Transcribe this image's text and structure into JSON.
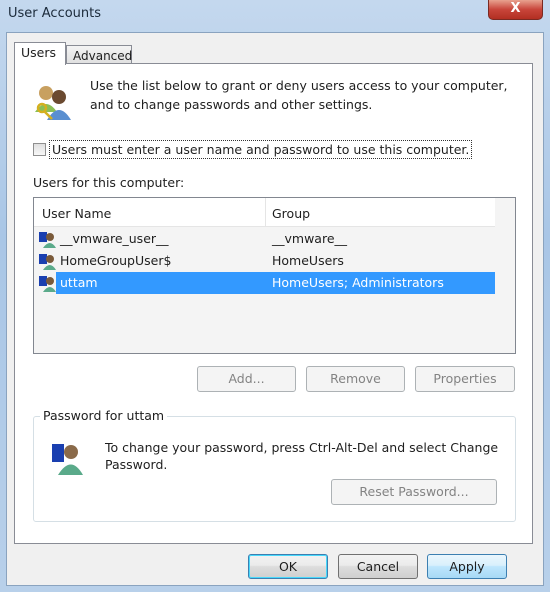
{
  "window": {
    "title": "User Accounts",
    "close_label": "X"
  },
  "tabs": [
    {
      "label": "Users",
      "active": true
    },
    {
      "label": "Advanced",
      "active": false
    }
  ],
  "intro": {
    "line1": "Use the list below to grant or deny users access to your computer,",
    "line2": "and to change passwords and other settings."
  },
  "checkbox": {
    "label": "Users must enter a user name and password to use this computer.",
    "checked": false
  },
  "users_label": "Users for this computer:",
  "table": {
    "columns": [
      "User Name",
      "Group"
    ],
    "rows": [
      {
        "name": "__vmware_user__",
        "group": "__vmware__",
        "selected": false
      },
      {
        "name": "HomeGroupUser$",
        "group": "HomeUsers",
        "selected": false
      },
      {
        "name": "uttam",
        "group": "HomeUsers; Administrators",
        "selected": true
      }
    ]
  },
  "buttons": {
    "add": "Add...",
    "remove": "Remove",
    "properties": "Properties",
    "reset": "Reset Password...",
    "ok": "OK",
    "cancel": "Cancel",
    "apply": "Apply"
  },
  "password_group": {
    "title": "Password for uttam",
    "line1": "To change your password, press Ctrl-Alt-Del and select Change",
    "line2": "Password."
  },
  "colors": {
    "selection": "#3399ff",
    "close": "#c8453a"
  }
}
